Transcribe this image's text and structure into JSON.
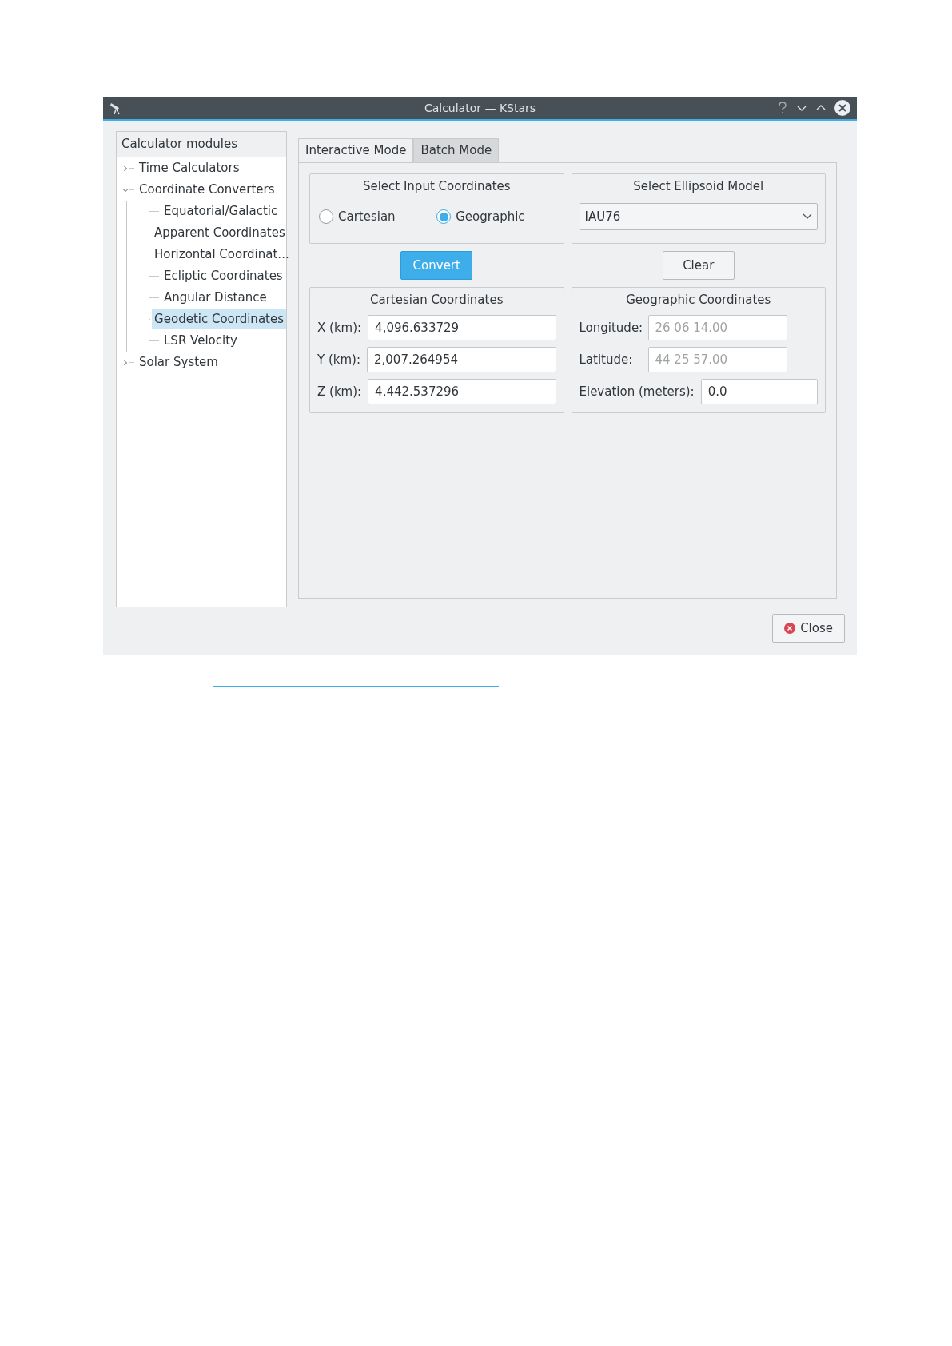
{
  "window": {
    "title": "Calculator — KStars"
  },
  "sidebar": {
    "header": "Calculator modules",
    "items": [
      {
        "label": "Time Calculators",
        "expanded": false,
        "selected": false
      },
      {
        "label": "Coordinate Converters",
        "expanded": true,
        "selected": false,
        "children": [
          {
            "label": "Equatorial/Galactic",
            "selected": false
          },
          {
            "label": "Apparent Coordinates",
            "selected": false
          },
          {
            "label": "Horizontal Coordinat...",
            "selected": false
          },
          {
            "label": "Ecliptic Coordinates",
            "selected": false
          },
          {
            "label": "Angular Distance",
            "selected": false
          },
          {
            "label": "Geodetic Coordinates",
            "selected": true
          },
          {
            "label": "LSR Velocity",
            "selected": false
          }
        ]
      },
      {
        "label": "Solar System",
        "expanded": false,
        "selected": false
      }
    ]
  },
  "tabs": [
    {
      "label": "Interactive Mode",
      "selected": true
    },
    {
      "label": "Batch Mode",
      "selected": false
    }
  ],
  "input_group": {
    "title": "Select Input Coordinates",
    "options": [
      {
        "label": "Cartesian",
        "selected": false
      },
      {
        "label": "Geographic",
        "selected": true
      }
    ]
  },
  "ellipsoid_group": {
    "title": "Select Ellipsoid Model",
    "value": "IAU76"
  },
  "buttons": [
    {
      "label": "Convert",
      "kind": "primary"
    },
    {
      "label": "Clear",
      "kind": "plain"
    }
  ],
  "cartesian_group": {
    "title": "Cartesian Coordinates",
    "fields": [
      {
        "label": "X (km):",
        "value": "4,096.633729",
        "disabled": false
      },
      {
        "label": "Y (km):",
        "value": "2,007.264954",
        "disabled": false
      },
      {
        "label": "Z (km):",
        "value": "4,442.537296",
        "disabled": false
      }
    ]
  },
  "geographic_group": {
    "title": "Geographic Coordinates",
    "fields": [
      {
        "label": "Longitude:",
        "value": "26 06 14.00",
        "disabled": true
      },
      {
        "label": "Latitude:",
        "value": "44 25 57.00",
        "disabled": true
      },
      {
        "label": "Elevation (meters):",
        "value": "0.0",
        "disabled": false
      }
    ]
  },
  "footer": {
    "close_button": "Close"
  }
}
